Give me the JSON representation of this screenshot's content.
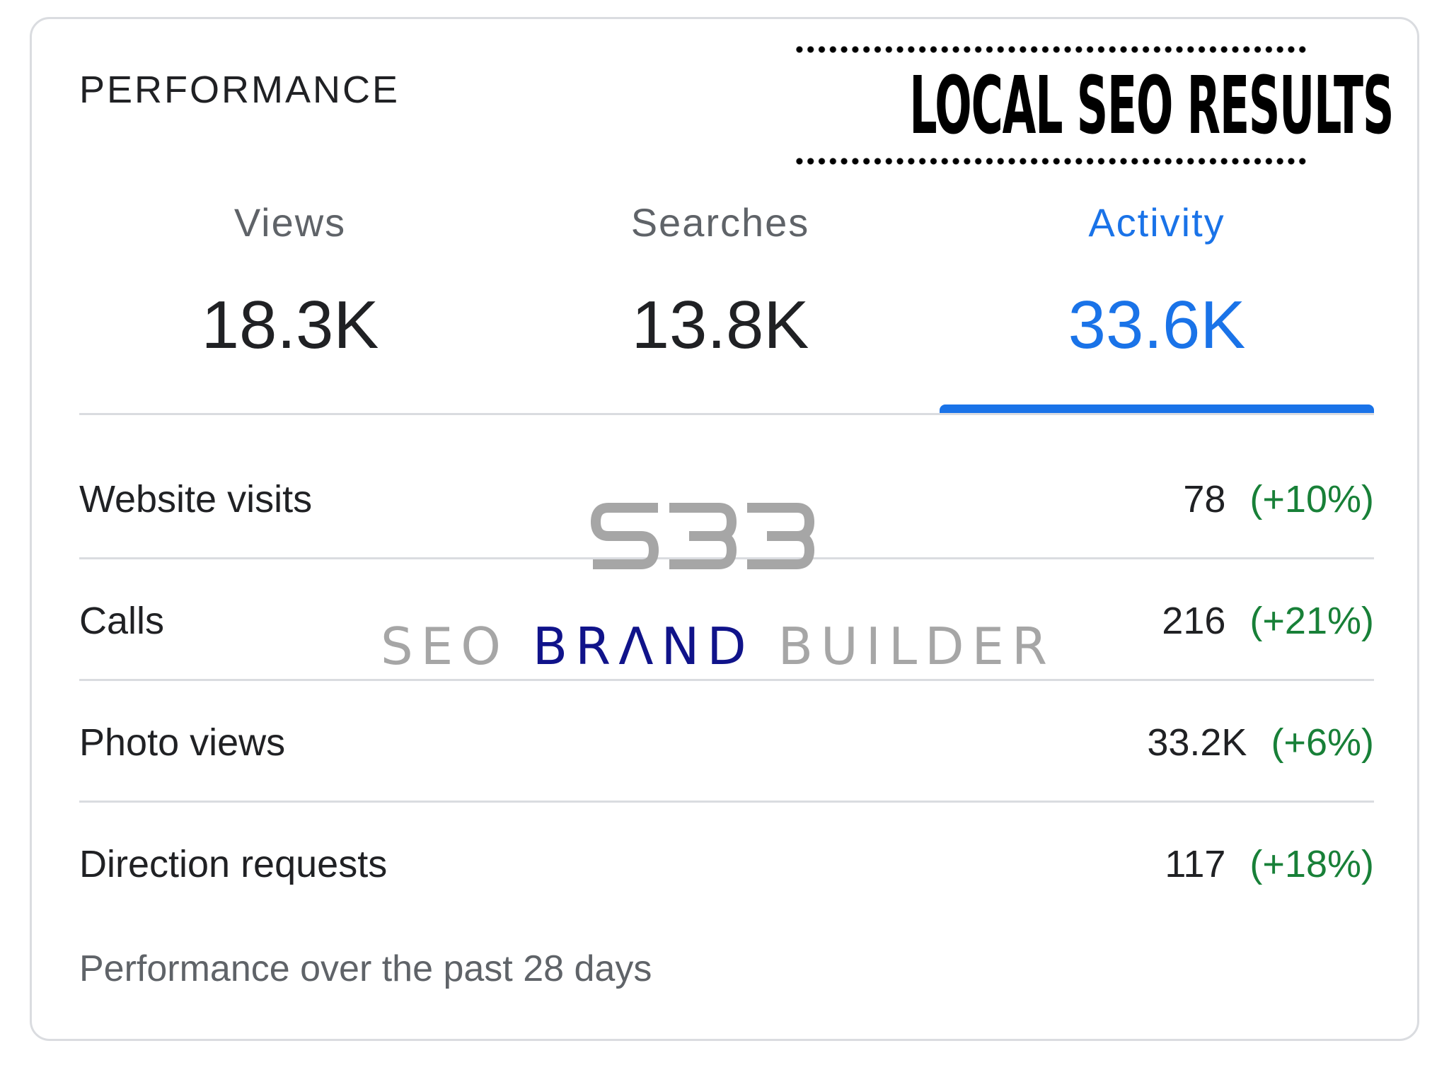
{
  "card": {
    "title": "PERFORMANCE",
    "banner_text": "LOCAL SEO RESULTS"
  },
  "tabs": [
    {
      "label": "Views",
      "value": "18.3K",
      "active": false
    },
    {
      "label": "Searches",
      "value": "13.8K",
      "active": false
    },
    {
      "label": "Activity",
      "value": "33.6K",
      "active": true
    }
  ],
  "metrics": [
    {
      "label": "Website visits",
      "value": "78",
      "change": "(+10%)"
    },
    {
      "label": "Calls",
      "value": "216",
      "change": "(+21%)"
    },
    {
      "label": "Photo views",
      "value": "33.2K",
      "change": "(+6%)"
    },
    {
      "label": "Direction requests",
      "value": "117",
      "change": "(+18%)"
    }
  ],
  "footer": {
    "note": "Performance over the past 28 days"
  },
  "watermark": {
    "logo_text": "SBB",
    "word1": "SEO",
    "word2": "BRΛND",
    "word3": "BUILDER"
  },
  "colors": {
    "accent": "#1a73e8",
    "positive": "#188038",
    "text_primary": "#202124",
    "text_secondary": "#5f6368",
    "divider": "#dadce0",
    "watermark_grey": "#a6a6a6",
    "watermark_navy": "#10138a"
  }
}
